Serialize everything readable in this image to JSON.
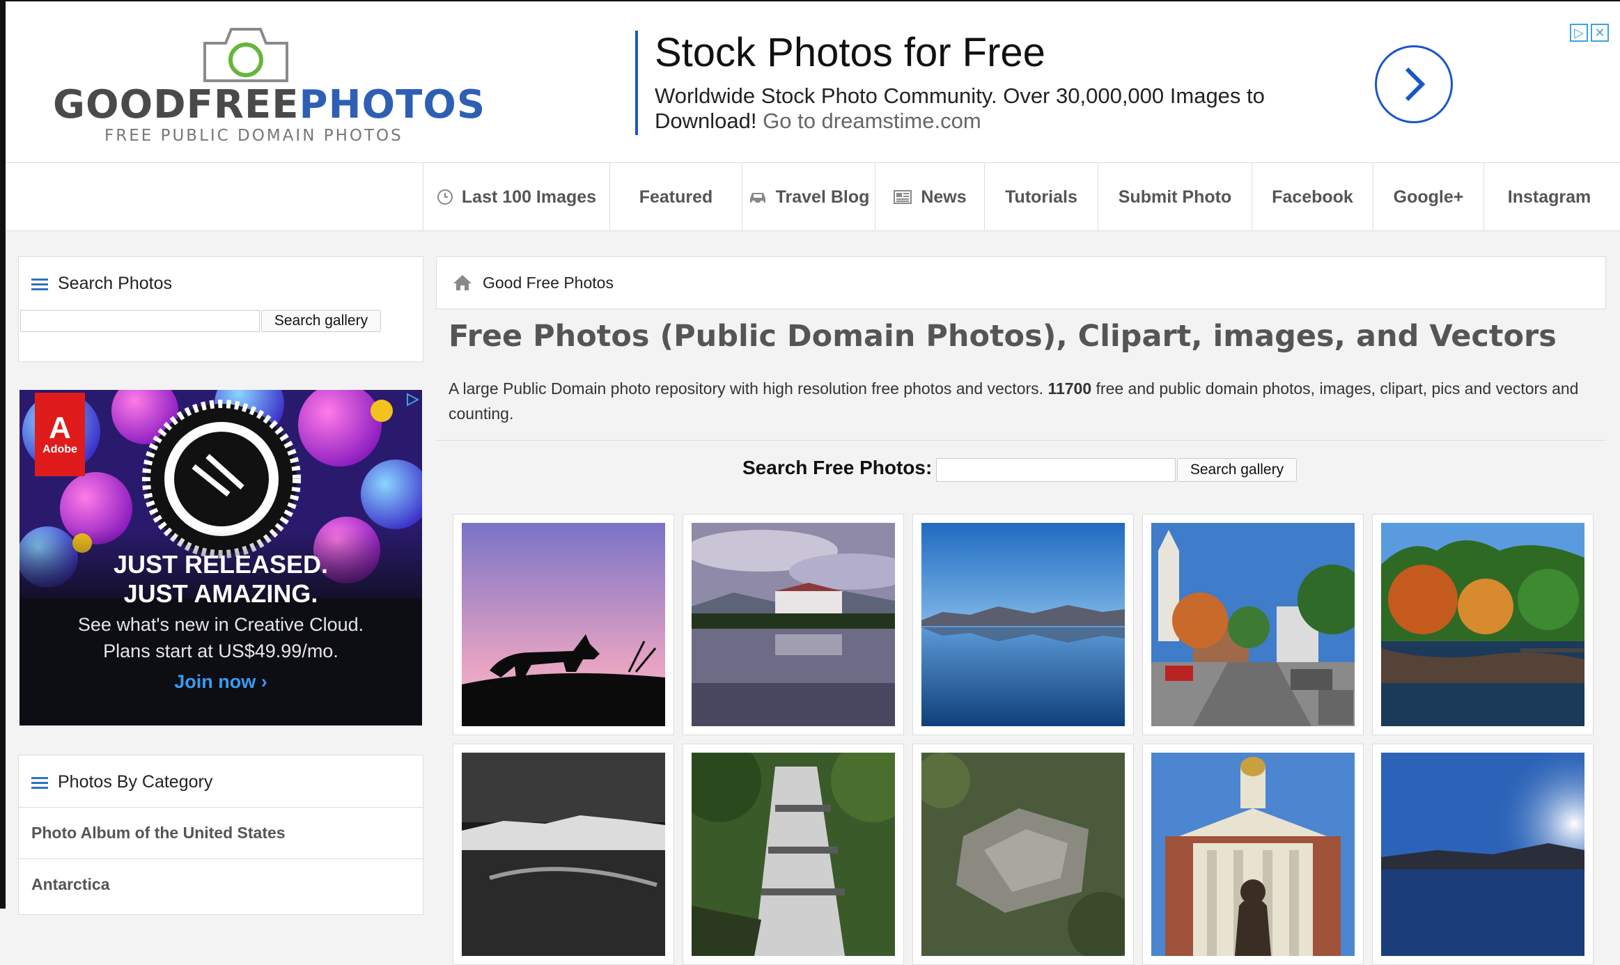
{
  "header": {
    "logo": {
      "brand_main": "GOODFREE",
      "brand_accent": "PHOTOS",
      "tagline": "FREE PUBLIC DOMAIN PHOTOS"
    },
    "ad": {
      "headline": "Stock Photos for Free",
      "line1": "Worldwide Stock Photo Community. Over 30,000,000 Images to",
      "line2": "Download!",
      "link": "Go to dreamstime.com"
    }
  },
  "nav": {
    "items": [
      {
        "label": "Last 100 Images",
        "icon": "clock-icon"
      },
      {
        "label": "Featured"
      },
      {
        "label": "Travel Blog",
        "icon": "car-icon"
      },
      {
        "label": "News",
        "icon": "newspaper-icon"
      },
      {
        "label": "Tutorials"
      },
      {
        "label": "Submit Photo"
      },
      {
        "label": "Facebook"
      },
      {
        "label": "Google+"
      },
      {
        "label": "Instagram"
      }
    ]
  },
  "sidebar": {
    "search_title": "Search Photos",
    "search_button": "Search gallery",
    "ad": {
      "brand": "Adobe",
      "headline1": "JUST RELEASED.",
      "headline2": "JUST AMAZING.",
      "line1": "See what's new in Creative Cloud.",
      "line2": "Plans start at US$49.99/mo.",
      "cta": "Join now ›"
    },
    "category_title": "Photos By Category",
    "categories": [
      "Photo Album of the United States",
      "Antarctica"
    ]
  },
  "main": {
    "breadcrumb": "Good Free Photos",
    "title": "Free Photos (Public Domain Photos), Clipart, images, and Vectors",
    "desc_pre": "A large Public Domain photo repository with high resolution free photos and vectors. ",
    "desc_count": "11700",
    "desc_post": " free and public domain photos, images, clipart, pics and vectors and counting.",
    "search_label": "Search Free Photos:",
    "search_button": "Search gallery",
    "thumbnails": [
      "fox-silhouette",
      "hotel-lake-reflection",
      "mountain-lake-reflection",
      "town-street-autumn",
      "autumn-pond",
      "snowy-mountains",
      "waterfall",
      "aerial-rocks",
      "courthouse-statue",
      "sunlit-lake"
    ]
  }
}
